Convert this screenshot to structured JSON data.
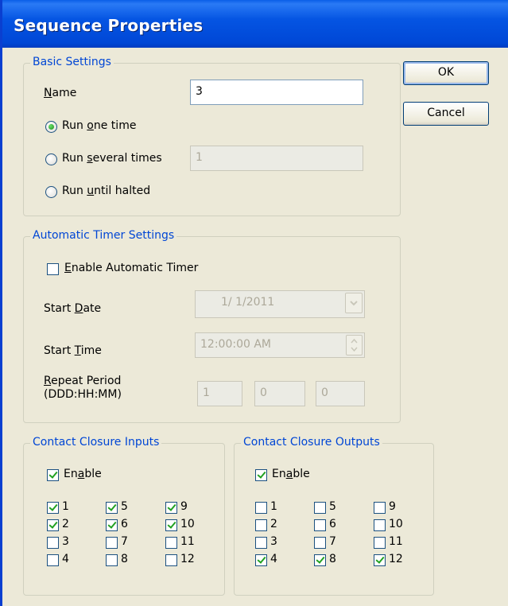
{
  "window": {
    "title": "Sequence Properties"
  },
  "buttons": {
    "ok": "OK",
    "cancel": "Cancel"
  },
  "basic": {
    "legend": "Basic Settings",
    "name_label_u": "N",
    "name_label_rest": "ame",
    "name_value": "3",
    "run_one_a": "Run ",
    "run_one_u": "o",
    "run_one_b": "ne time",
    "run_several_a": "Run ",
    "run_several_u": "s",
    "run_several_b": "everal times",
    "run_several_value": "1",
    "run_until_a": "Run ",
    "run_until_u": "u",
    "run_until_b": "ntil halted",
    "selected": "run_one_time"
  },
  "timer": {
    "legend": "Automatic Timer Settings",
    "enable_u": "E",
    "enable_rest": "nable Automatic Timer",
    "enabled": false,
    "start_date_a": "Start ",
    "start_date_u": "D",
    "start_date_b": "ate",
    "start_date_value": "1/ 1/2011",
    "start_time_a": "Start ",
    "start_time_u": "T",
    "start_time_b": "ime",
    "start_time_value": "12:00:00 AM",
    "repeat_u": "R",
    "repeat_rest": "epeat Period",
    "repeat_format": "(DDD:HH:MM)",
    "repeat_days": "1",
    "repeat_hours": "0",
    "repeat_minutes": "0"
  },
  "inputs": {
    "legend": "Contact Closure Inputs",
    "enable_a": "En",
    "enable_u": "a",
    "enable_b": "ble",
    "enabled": true,
    "items": [
      {
        "label": "1",
        "checked": true
      },
      {
        "label": "2",
        "checked": true
      },
      {
        "label": "3",
        "checked": false
      },
      {
        "label": "4",
        "checked": false
      },
      {
        "label": "5",
        "checked": true
      },
      {
        "label": "6",
        "checked": true
      },
      {
        "label": "7",
        "checked": false
      },
      {
        "label": "8",
        "checked": false
      },
      {
        "label": "9",
        "checked": true
      },
      {
        "label": "10",
        "checked": true
      },
      {
        "label": "11",
        "checked": false
      },
      {
        "label": "12",
        "checked": false
      }
    ]
  },
  "outputs": {
    "legend": "Contact Closure Outputs",
    "enable_a": "En",
    "enable_u": "a",
    "enable_b": "ble",
    "enabled": true,
    "items": [
      {
        "label": "1",
        "checked": false
      },
      {
        "label": "2",
        "checked": false
      },
      {
        "label": "3",
        "checked": false
      },
      {
        "label": "4",
        "checked": true
      },
      {
        "label": "5",
        "checked": false
      },
      {
        "label": "6",
        "checked": false
      },
      {
        "label": "7",
        "checked": false
      },
      {
        "label": "8",
        "checked": true
      },
      {
        "label": "9",
        "checked": false
      },
      {
        "label": "10",
        "checked": false
      },
      {
        "label": "11",
        "checked": false
      },
      {
        "label": "12",
        "checked": true
      }
    ]
  }
}
